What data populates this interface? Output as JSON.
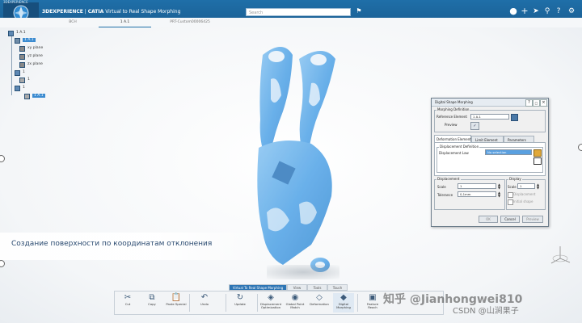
{
  "window": {
    "brand": "3DEXPERIENCE",
    "app_name": "CATIA",
    "app_title": "Virtual to Real Shape Morphing",
    "search_placeholder": "Search",
    "corner_label": "3DEXPERIENCE"
  },
  "tabs": [
    {
      "label": "BCH"
    },
    {
      "label": "1 A.1"
    },
    {
      "label": "PRT-Custom00006425"
    }
  ],
  "tree": {
    "nodes": [
      {
        "label": "1 A.1"
      },
      {
        "label": "1 A.1"
      },
      {
        "label": "xy plane"
      },
      {
        "label": "yz plane"
      },
      {
        "label": "zx plane"
      },
      {
        "label": "1"
      },
      {
        "label": "1"
      },
      {
        "label": "1"
      },
      {
        "label": "1 A.1"
      }
    ]
  },
  "caption": "Создание поверхности по координатам отклонения",
  "dialog": {
    "title": "Digital Shape Morphing",
    "section_morphing": "Morphing Definition",
    "reference_label": "Reference Element",
    "reference_value": "1 A.1",
    "preview_label": "Preview",
    "tabs": [
      "Deformation Element",
      "Limit Element",
      "Parameters"
    ],
    "section_displacement_def": "Displacement Definition",
    "displacement_law_label": "Displacement Law",
    "displacement_law_value": "No selection",
    "section_displacement": "Displacement",
    "scale_label": "Scale",
    "scale_value": "1",
    "tolerance_label": "Tolerance",
    "tolerance_value": "0,1mm",
    "section_display": "Display",
    "display_scale_label": "Scale",
    "display_scale_value": "1",
    "option1": "Displacement",
    "option2": "Initial shape",
    "ok": "OK",
    "cancel": "Cancel",
    "preview_btn": "Preview"
  },
  "toolbar": {
    "tabs": [
      "Virtual To Real Shape Morphing",
      "View",
      "Tools",
      "Touch"
    ],
    "active_tab": "Virtual To Real Shape Morphing",
    "tools": [
      {
        "label": "Cut",
        "icon": "scissors-icon"
      },
      {
        "label": "Copy",
        "icon": "copy-icon"
      },
      {
        "label": "Paste Special",
        "icon": "paste-icon"
      },
      {
        "label": "Undo",
        "icon": "undo-icon"
      },
      {
        "label": "Update",
        "icon": "update-icon"
      },
      {
        "label": "Displacement Optimization",
        "icon": "displacement-opt-icon"
      },
      {
        "label": "Global Point Match",
        "icon": "point-match-icon"
      },
      {
        "label": "Deformation",
        "icon": "deformation-icon"
      },
      {
        "label": "Digital Morphing",
        "icon": "morphing-icon"
      },
      {
        "label": "Feature Reach",
        "icon": "feature-icon"
      }
    ]
  },
  "watermark": {
    "line1": "知乎 @Jianhongwei810",
    "line2": "CSDN @山涧果子"
  },
  "colors": {
    "brand_blue": "#1f6fa8",
    "model_blue": "#5aa8e8",
    "selection": "#3b8bd0"
  }
}
